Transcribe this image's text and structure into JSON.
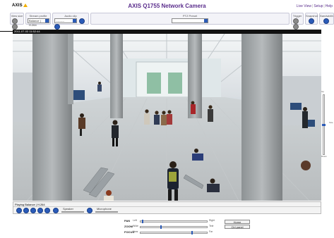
{
  "header": {
    "logo_text": "AXIS",
    "title": "AXIS Q1755 Network Camera",
    "links": [
      "Live View",
      "Setup",
      "Help"
    ],
    "accent_color": "#5a2d8c"
  },
  "toolbar": {
    "view_size": {
      "label": "View size"
    },
    "stream_profile": {
      "label": "Stream profile",
      "value": "Balance  | H.264"
    },
    "audio_clip": {
      "label": "Audio clip",
      "value": "---------"
    },
    "ptz_preset": {
      "label": "PTZ Preset",
      "value": ""
    },
    "trigger": {
      "label": "Trigger"
    },
    "snapshot": {
      "label": "Snapshot"
    },
    "bandwidth": {
      "label": "Bandwidth"
    }
  },
  "video": {
    "timestamp": "2011-07-03  11:52:44"
  },
  "zoom_slider": {
    "top_label": "Up",
    "bottom_label": "Down",
    "side_label": "Tele",
    "level": 0.5
  },
  "controls": {
    "playing_text": "Playing Balance | H.264",
    "speaker_label": "Speaker",
    "microphone_label": "Microphone"
  },
  "ptz": {
    "pan": {
      "label": "PAN",
      "low": "Left",
      "high": "Right",
      "value": 0.02
    },
    "zoom": {
      "label": "ZOOM",
      "low": "Wide",
      "high": "Tele",
      "value": 0.3
    },
    "focus": {
      "label": "FOCUS",
      "low": "Near",
      "high": "Far",
      "value": 0.78
    },
    "home_label": "Home",
    "ctrl_panel_label": "Ctrl panel"
  }
}
